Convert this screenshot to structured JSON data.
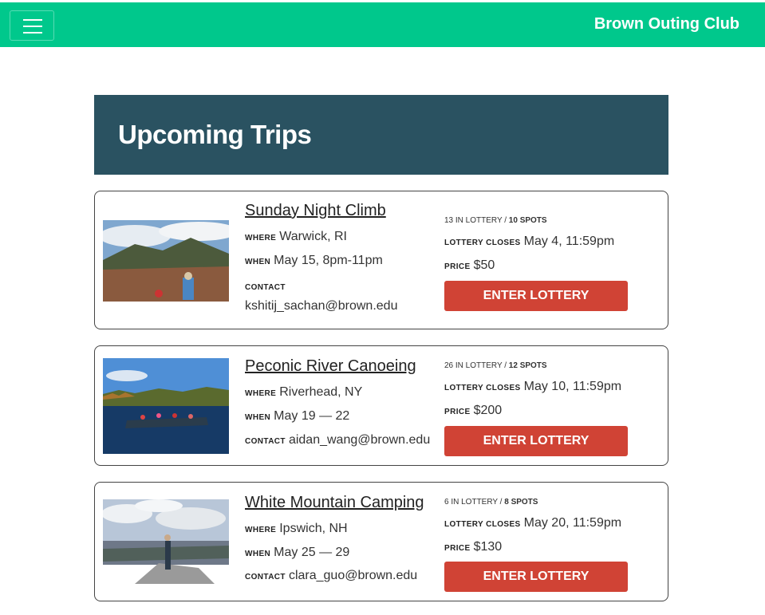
{
  "navbar": {
    "brand": "Brown Outing Club"
  },
  "header": {
    "title": "Upcoming Trips"
  },
  "labels": {
    "where": "WHERE",
    "when": "WHEN",
    "contact": "CONTACT",
    "lottery_closes": "LOTTERY CLOSES",
    "price": "PRICE",
    "in_lottery_suffix": "IN LOTTERY /",
    "spots_suffix": "SPOTS"
  },
  "trips": [
    {
      "title": "Sunday Night Climb",
      "where": "Warwick, RI",
      "when": "May 15, 8pm-11pm",
      "contact": "kshitij_sachan@brown.edu",
      "in_lottery": "13",
      "spots": "10",
      "lottery_closes": "May 4, 11:59pm",
      "price": "$50",
      "button": "ENTER LOTTERY"
    },
    {
      "title": "Peconic River Canoeing",
      "where": "Riverhead, NY",
      "when": "May 19 — 22",
      "contact": "aidan_wang@brown.edu",
      "in_lottery": "26",
      "spots": "12",
      "lottery_closes": "May 10, 11:59pm",
      "price": "$200",
      "button": "ENTER LOTTERY"
    },
    {
      "title": "White Mountain Camping",
      "where": "Ipswich, NH",
      "when": "May 25 — 29",
      "contact": "clara_guo@brown.edu",
      "in_lottery": "6",
      "spots": "8",
      "lottery_closes": "May 20, 11:59pm",
      "price": "$130",
      "button": "ENTER LOTTERY"
    }
  ],
  "colors": {
    "navbar": "#00c88c",
    "header": "#2a5261",
    "button": "#d04335"
  }
}
